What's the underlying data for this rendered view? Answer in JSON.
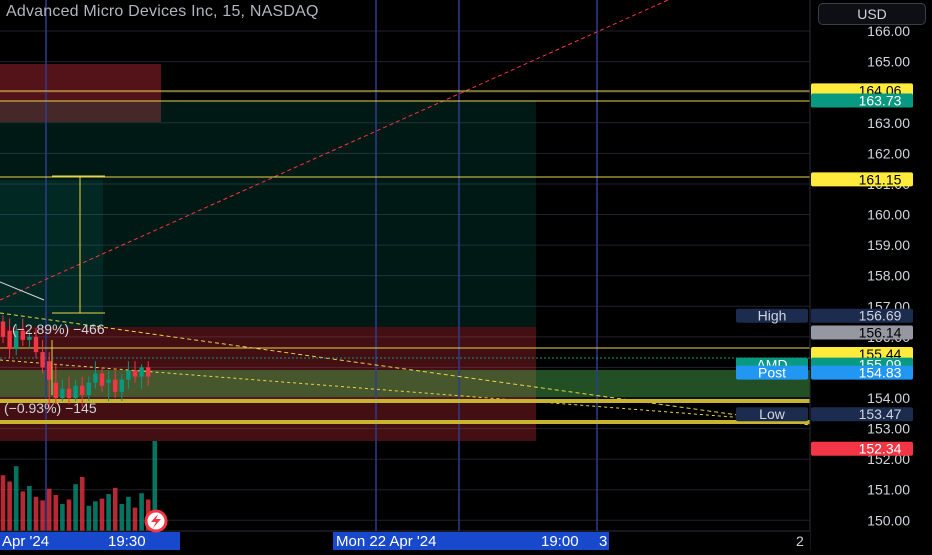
{
  "header": {
    "title": "Advanced Micro Devices Inc, 15, NASDAQ",
    "currency": "USD"
  },
  "price_axis": {
    "ticks": [
      "166.00",
      "165.00",
      "164.00",
      "163.00",
      "162.00",
      "161.00",
      "160.00",
      "159.00",
      "158.00",
      "157.00",
      "156.00",
      "155.00",
      "154.00",
      "153.00",
      "152.00",
      "151.00",
      "150.00"
    ],
    "range": [
      149.65,
      166.95
    ]
  },
  "time_axis": {
    "left_label": "Apr '24",
    "left_time": "19:30",
    "mid_label": "Mon 22 Apr '24",
    "mid_time": "19:00",
    "right_digit": "3",
    "page_num": "2"
  },
  "overlay_text": {
    "upper_measure": "(−2.89%) −466",
    "lower_measure": "(−0.93%) −145"
  },
  "price_tags": [
    {
      "value": "164.06",
      "bg": "#ffeb3b",
      "fg": "#000000"
    },
    {
      "value": "163.73",
      "bg": "#ffeb3b",
      "fg": "#000000"
    },
    {
      "value": "163.73",
      "bg": "#089981",
      "fg": "#ffffff"
    },
    {
      "value": "161.15",
      "bg": "#ffeb3b",
      "fg": "#000000"
    },
    {
      "value": "156.69",
      "bg": "#1c2c4f",
      "fg": "#d1d4dc",
      "label": "High"
    },
    {
      "value": "156.14",
      "bg": "#9598a1",
      "fg": "#000000"
    },
    {
      "value": "155.44",
      "bg": "#ffeb3b",
      "fg": "#000000"
    },
    {
      "value": "155.09",
      "bg": "#089981",
      "fg": "#ffffff",
      "label": "AMD"
    },
    {
      "value": "154.83",
      "bg": "#2196f3",
      "fg": "#ffffff",
      "label": "Post"
    },
    {
      "value": "153.47",
      "bg": "#1c2c4f",
      "fg": "#d1d4dc",
      "label": "Low"
    },
    {
      "value": "152.34",
      "bg": "#f23645",
      "fg": "#ffffff"
    }
  ],
  "colors": {
    "up": "#089981",
    "down": "#f23645",
    "grid": "#1f222b",
    "vertical_line": "#2f3b8f",
    "yellow": "#e6d44a"
  },
  "chart_data": {
    "type": "candlestick",
    "title": "Advanced Micro Devices Inc, 15, NASDAQ",
    "ylim": [
      149.65,
      166.95
    ],
    "candles": [
      {
        "o": 156.5,
        "h": 156.7,
        "c": 156.0,
        "l": 155.8
      },
      {
        "o": 156.2,
        "h": 156.6,
        "c": 155.6,
        "l": 155.3
      },
      {
        "o": 155.6,
        "h": 156.4,
        "c": 156.2,
        "l": 155.4
      },
      {
        "o": 156.2,
        "h": 156.6,
        "c": 155.9,
        "l": 155.7
      },
      {
        "o": 155.9,
        "h": 156.2,
        "c": 156.0,
        "l": 155.6
      },
      {
        "o": 156.0,
        "h": 156.3,
        "c": 155.5,
        "l": 155.3
      },
      {
        "o": 155.5,
        "h": 155.9,
        "c": 155.0,
        "l": 154.8
      },
      {
        "o": 155.2,
        "h": 155.5,
        "c": 154.6,
        "l": 153.6
      },
      {
        "o": 154.5,
        "h": 155.1,
        "c": 154.0,
        "l": 153.8
      },
      {
        "o": 154.0,
        "h": 154.6,
        "c": 154.3,
        "l": 153.9
      },
      {
        "o": 154.3,
        "h": 154.7,
        "c": 154.0,
        "l": 153.8
      },
      {
        "o": 154.0,
        "h": 154.6,
        "c": 154.4,
        "l": 153.9
      },
      {
        "o": 154.4,
        "h": 154.7,
        "c": 154.1,
        "l": 153.7
      },
      {
        "o": 154.1,
        "h": 154.7,
        "c": 154.5,
        "l": 153.9
      },
      {
        "o": 154.5,
        "h": 155.2,
        "c": 154.8,
        "l": 154.3
      },
      {
        "o": 154.8,
        "h": 155.0,
        "c": 154.4,
        "l": 154.2
      },
      {
        "o": 154.5,
        "h": 154.9,
        "c": 154.6,
        "l": 153.9
      },
      {
        "o": 154.6,
        "h": 154.9,
        "c": 154.2,
        "l": 154.0
      },
      {
        "o": 154.2,
        "h": 154.8,
        "c": 154.6,
        "l": 153.9
      },
      {
        "o": 154.6,
        "h": 155.2,
        "c": 154.9,
        "l": 154.3
      },
      {
        "o": 154.9,
        "h": 155.2,
        "c": 154.7,
        "l": 154.5
      },
      {
        "o": 154.7,
        "h": 155.1,
        "c": 155.0,
        "l": 154.3
      },
      {
        "o": 155.0,
        "h": 155.2,
        "c": 154.7,
        "l": 154.4
      }
    ],
    "volumes": [
      0.62,
      0.55,
      0.72,
      0.44,
      0.5,
      0.38,
      0.34,
      0.47,
      0.4,
      0.3,
      0.35,
      0.52,
      0.6,
      0.28,
      0.33,
      0.36,
      0.41,
      0.48,
      0.3,
      0.38,
      0.26,
      0.42,
      0.35,
      1.0
    ],
    "levels": [
      164.06,
      163.73,
      161.15,
      156.69,
      155.44,
      153.47,
      152.34
    ]
  }
}
